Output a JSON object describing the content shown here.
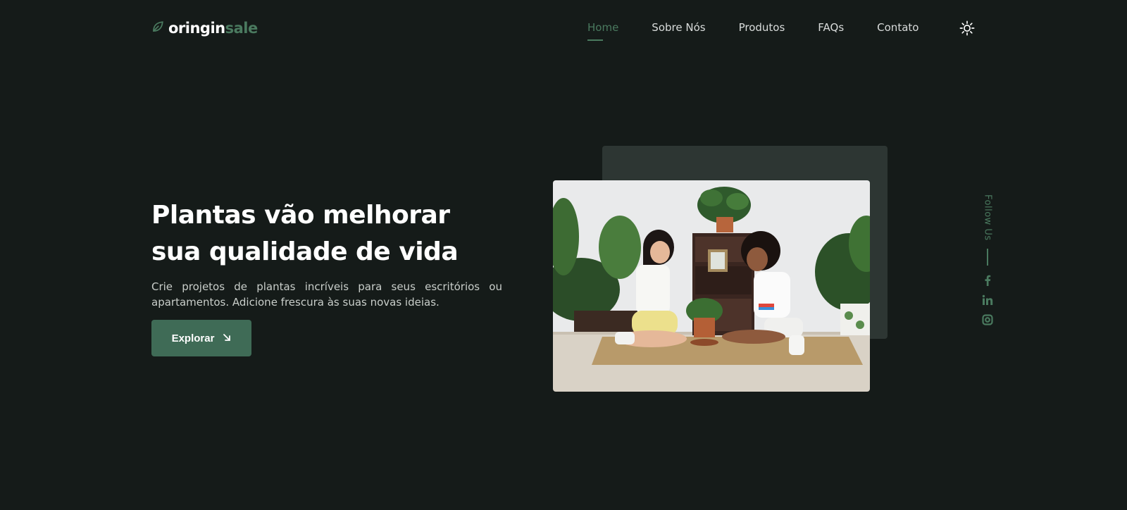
{
  "brand": {
    "name_part1": "oringin",
    "name_part2": "sale",
    "icon": "leaf-icon"
  },
  "nav": {
    "items": [
      {
        "label": "Home",
        "active": true
      },
      {
        "label": "Sobre Nós",
        "active": false
      },
      {
        "label": "Produtos",
        "active": false
      },
      {
        "label": "FAQs",
        "active": false
      },
      {
        "label": "Contato",
        "active": false
      }
    ],
    "theme_toggle_icon": "sun-icon"
  },
  "hero": {
    "title_line1": "Plantas vão melhorar",
    "title_line2": "sua qualidade de vida",
    "description": "Crie projetos de plantas incríveis para seus escritórios ou apartamentos. Adicione frescura às suas novas ideias.",
    "button_label": "Explorar",
    "button_icon": "arrow-down-right-icon"
  },
  "follow": {
    "label": "Follow Us",
    "socials": [
      "facebook-icon",
      "linkedin-icon",
      "instagram-icon"
    ]
  },
  "colors": {
    "background": "#151b19",
    "accent": "#4a7a5f",
    "button": "#3f6b56",
    "backdrop": "#2d3633"
  }
}
